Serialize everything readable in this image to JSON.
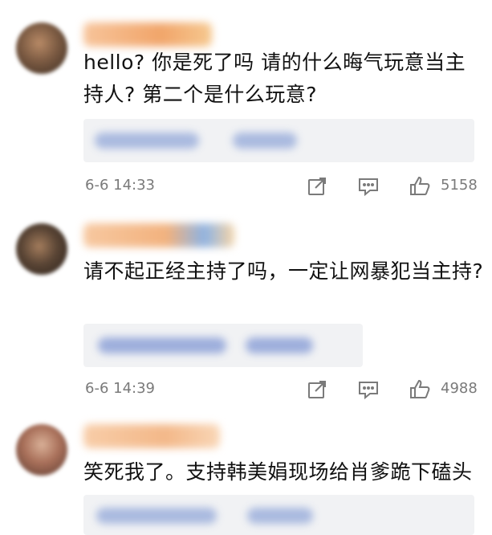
{
  "comments": [
    {
      "text": "hello? 你是死了吗 请的什么晦气玩意当主持人? 第二个是什么玩意?",
      "time": "6-6 14:33",
      "likes": "5158"
    },
    {
      "text": "请不起正经主持了吗，一定让网暴犯当主持?",
      "time": "6-6 14:39",
      "likes": "4988"
    },
    {
      "text": "笑死我了。支持韩美娟现场给肖爹跪下磕头",
      "time": "",
      "likes": ""
    }
  ],
  "icons": {
    "share": "share-icon",
    "comment": "comment-icon",
    "like": "like-icon"
  },
  "colors": {
    "name_blur": "#f4b27a",
    "reply_bg": "#f1f2f4",
    "meta_text": "#7a7a7a",
    "reply_blur": "#8ea2d8"
  }
}
